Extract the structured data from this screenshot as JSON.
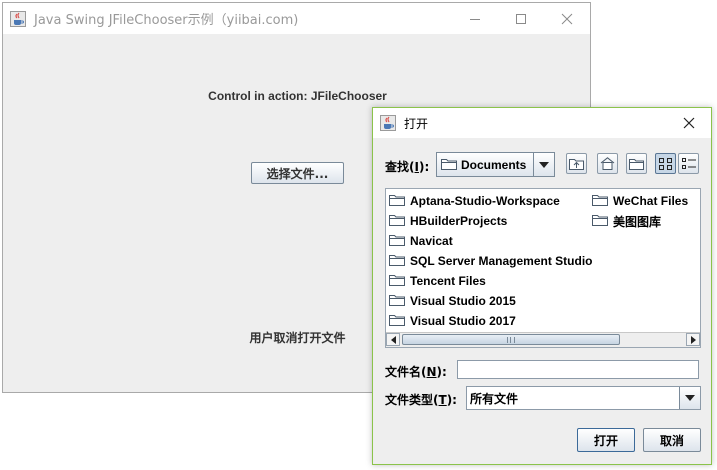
{
  "main_window": {
    "title": "Java Swing JFileChooser示例（yiibai.com)",
    "header_label": "Control in action: JFileChooser",
    "choose_button": "选择文件...",
    "status_label": "用户取消打开文件"
  },
  "dialog": {
    "title": "打开",
    "lookin_label": "查找(",
    "lookin_mnemonic": "I",
    "lookin_suffix": "):",
    "lookin_value": "Documents",
    "toolbar": [
      "up-folder-icon",
      "home-icon",
      "new-folder-icon",
      "list-view-icon",
      "details-view-icon"
    ],
    "files": [
      "Aptana-Studio-Workspace",
      "HBuilderProjects",
      "Navicat",
      "SQL Server Management Studio",
      "Tencent Files",
      "Visual Studio 2015",
      "Visual Studio 2017",
      "WeChat Files",
      "美图图库"
    ],
    "filename_label": "文件名(",
    "filename_mnemonic": "N",
    "filename_suffix": "):",
    "filename_value": "",
    "filetype_label": "文件类型(",
    "filetype_mnemonic": "T",
    "filetype_suffix": "):",
    "filetype_value": "所有文件",
    "open_button": "打开",
    "cancel_button": "取消"
  },
  "colors": {
    "dialog_border": "#8bc34a",
    "window_bg": "#eeeeee"
  }
}
